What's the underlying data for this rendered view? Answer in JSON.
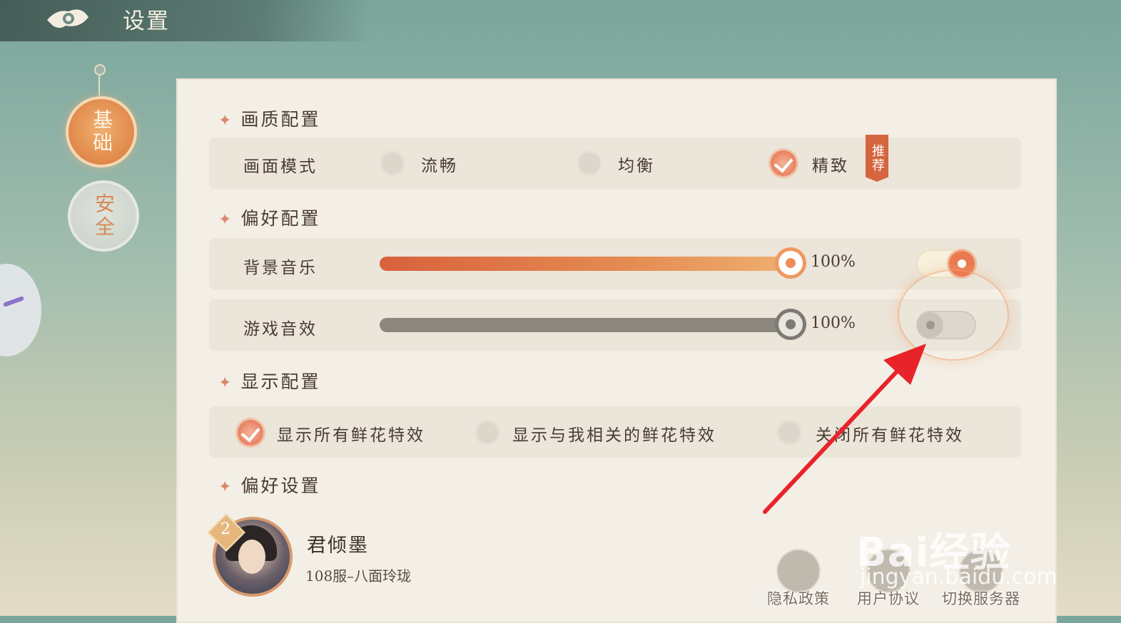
{
  "header": {
    "title": "设置"
  },
  "tabs": [
    {
      "label": "基础",
      "active": true
    },
    {
      "label": "安全",
      "active": false
    }
  ],
  "sections": {
    "quality": {
      "title": "画质配置",
      "row_label": "画面模式",
      "options": [
        {
          "label": "流畅",
          "selected": false
        },
        {
          "label": "均衡",
          "selected": false
        },
        {
          "label": "精致",
          "selected": true
        }
      ],
      "recommend_badge": "推荐"
    },
    "preference": {
      "title": "偏好配置",
      "music": {
        "label": "背景音乐",
        "value_text": "100%",
        "level": 1.0,
        "enabled": true
      },
      "sfx": {
        "label": "游戏音效",
        "value_text": "100%",
        "level": 1.0,
        "enabled": false
      }
    },
    "display": {
      "title": "显示配置",
      "options": [
        {
          "label": "显示所有鲜花特效",
          "selected": true
        },
        {
          "label": "显示与我相关的鲜花特效",
          "selected": false
        },
        {
          "label": "关闭所有鲜花特效",
          "selected": false
        }
      ]
    },
    "settings": {
      "title": "偏好设置"
    }
  },
  "player": {
    "level": "2",
    "name": "君倾墨",
    "server": "108服–八面玲珑"
  },
  "footer": {
    "privacy": "隐私政策",
    "agreement": "用户协议",
    "switch_server": "切换服务器"
  },
  "watermark": {
    "main": "Bai经验",
    "sub": "jingyan.baidu.com"
  },
  "colors": {
    "accent": "#e8835a",
    "panel": "#f3efe6",
    "text": "#4a3a33"
  },
  "icons": {
    "back": "cloud-back-icon",
    "section": "sparkle-icon"
  }
}
